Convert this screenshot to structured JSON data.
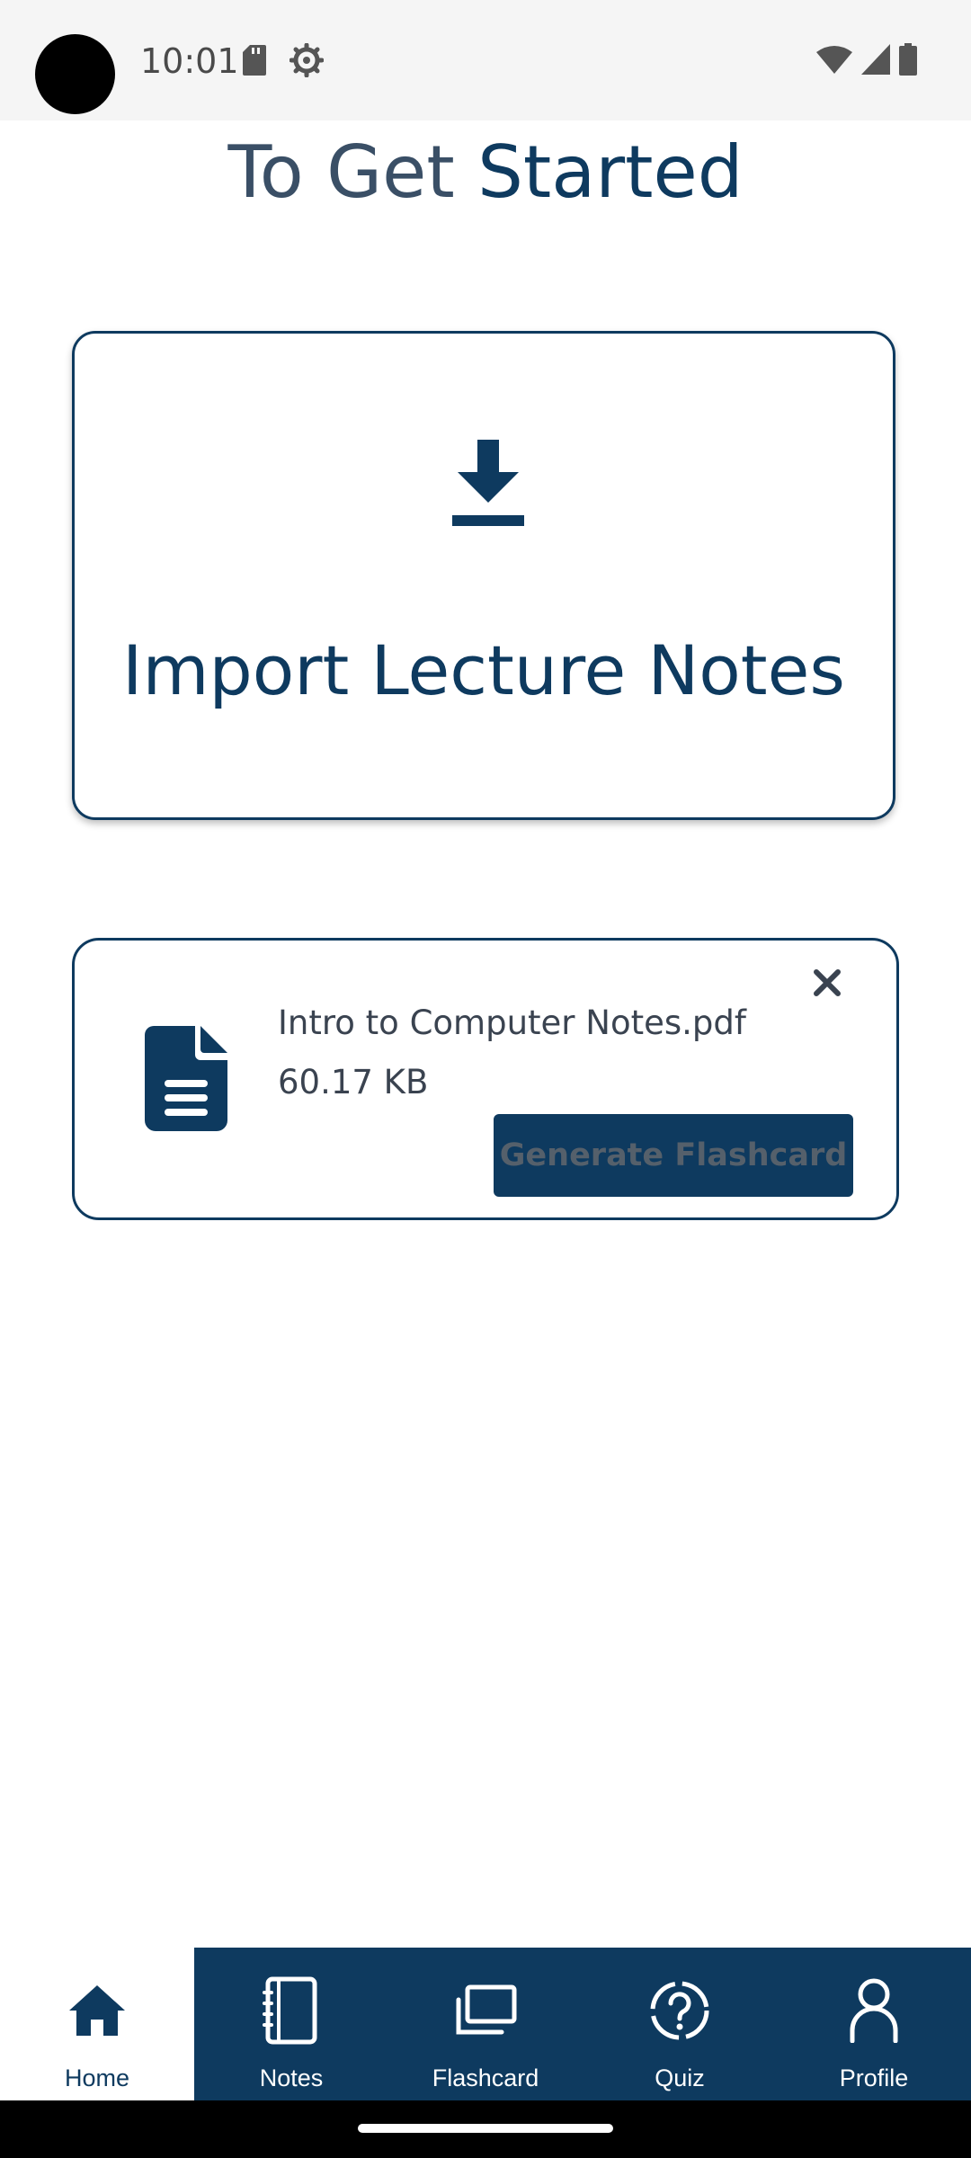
{
  "status_bar": {
    "time": "10:01"
  },
  "page": {
    "title_part1": "To Get ",
    "title_part2": "Started"
  },
  "import_card": {
    "icon": "download-icon",
    "label": "Import Lecture Notes"
  },
  "file_card": {
    "icon": "file-document-icon",
    "file_name": "Intro to Computer Notes.pdf",
    "file_size": "60.17 KB",
    "close_icon": "close-icon",
    "generate_label": "Generate Flashcard"
  },
  "nav": {
    "items": [
      {
        "label": "Home",
        "icon": "home-icon",
        "active": true
      },
      {
        "label": "Notes",
        "icon": "notebook-icon",
        "active": false
      },
      {
        "label": "Flashcard",
        "icon": "cards-icon",
        "active": false
      },
      {
        "label": "Quiz",
        "icon": "help-circle-icon",
        "active": false
      },
      {
        "label": "Profile",
        "icon": "person-icon",
        "active": false
      }
    ]
  },
  "colors": {
    "primary": "#0e3a5f",
    "background": "#ffffff",
    "status_bar": "#f5f5f5"
  }
}
